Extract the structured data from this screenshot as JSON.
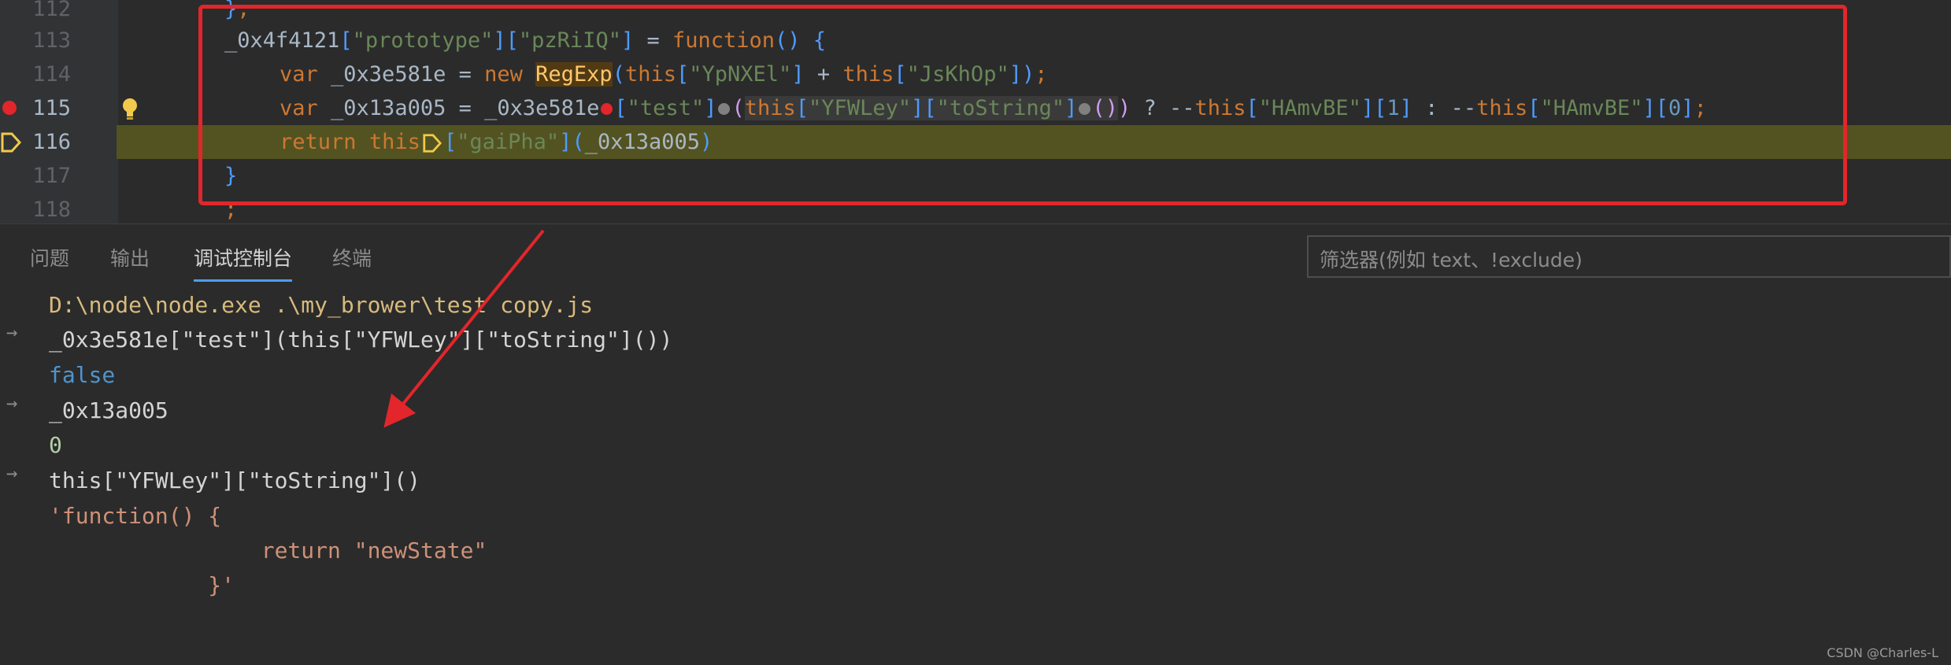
{
  "editor": {
    "lines": [
      {
        "num": "112",
        "text": "};"
      },
      {
        "num": "113",
        "text": "_0x4f4121[\"prototype\"][\"pzRiIQ\"] = function() {"
      },
      {
        "num": "114",
        "text": "var _0x3e581e = new RegExp(this[\"YpNXEl\"] + this[\"JsKhOp\"]);"
      },
      {
        "num": "115",
        "text": "var _0x13a005 = _0x3e581e[\"test\"](this[\"YFWLey\"][\"toString\"]()) ? --this[\"HAmvBE\"][1] : --this[\"HAmvBE\"][0];"
      },
      {
        "num": "116",
        "text": "return this[\"gaiPha\"](_0x13a005)"
      },
      {
        "num": "117",
        "text": "}"
      },
      {
        "num": "118",
        "text": ";"
      }
    ]
  },
  "panel": {
    "tabs": [
      "问题",
      "输出",
      "调试控制台",
      "终端"
    ],
    "active_tab": "调试控制台",
    "filter_placeholder": "筛选器(例如 text、!exclude)"
  },
  "console": {
    "lines": [
      {
        "type": "path",
        "text": "D:\\node\\node.exe .\\my_brower\\test copy.js"
      },
      {
        "type": "input",
        "text": "_0x3e581e[\"test\"](this[\"YFWLey\"][\"toString\"]())"
      },
      {
        "type": "false",
        "text": "false"
      },
      {
        "type": "input",
        "text": "_0x13a005"
      },
      {
        "type": "zero",
        "text": "0"
      },
      {
        "type": "input",
        "text": "this[\"YFWLey\"][\"toString\"]()"
      },
      {
        "type": "fnstr",
        "text": "'function() {"
      },
      {
        "type": "fnstr",
        "text": "                return \"newState\""
      },
      {
        "type": "fnstr",
        "text": "            }'"
      }
    ]
  },
  "watermark": "CSDN @Charles-L",
  "colors": {
    "annotation": "#e2262b",
    "highlight_line": "#535321"
  }
}
